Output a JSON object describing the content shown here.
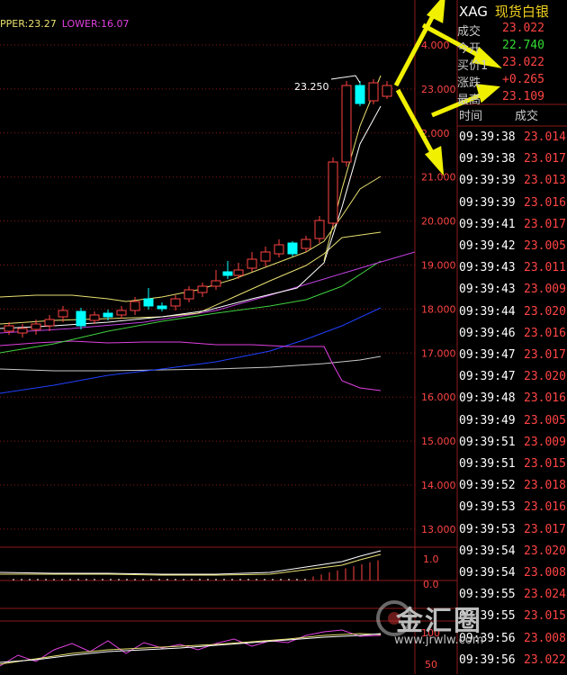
{
  "indicator_top": {
    "upper": "PPER:23.27",
    "lower": "LOWER:16.07"
  },
  "symbol": {
    "code": "XAG",
    "name": "现货白银"
  },
  "quote": [
    {
      "label": "成交",
      "value": "23.022",
      "color": "#ff4444"
    },
    {
      "label": "今开",
      "value": "22.740",
      "color": "#33dd33"
    },
    {
      "label": "买价1",
      "value": "23.022",
      "color": "#ff4444"
    },
    {
      "label": "涨跌",
      "value": "+0.265",
      "color": "#ff4444"
    },
    {
      "label": "最高",
      "value": "23.109",
      "color": "#ff4444"
    }
  ],
  "ticks_header": {
    "time": "时间",
    "price": "成交"
  },
  "ticks": [
    {
      "time": "09:39:38",
      "price": "23.014"
    },
    {
      "time": "09:39:38",
      "price": "23.017"
    },
    {
      "time": "09:39:39",
      "price": "23.013"
    },
    {
      "time": "09:39:39",
      "price": "23.016"
    },
    {
      "time": "09:39:41",
      "price": "23.017"
    },
    {
      "time": "09:39:42",
      "price": "23.005"
    },
    {
      "time": "09:39:43",
      "price": "23.011"
    },
    {
      "time": "09:39:43",
      "price": "23.009"
    },
    {
      "time": "09:39:44",
      "price": "23.020"
    },
    {
      "time": "09:39:46",
      "price": "23.016"
    },
    {
      "time": "09:39:47",
      "price": "23.017"
    },
    {
      "time": "09:39:47",
      "price": "23.020"
    },
    {
      "time": "09:39:48",
      "price": "23.016"
    },
    {
      "time": "09:39:49",
      "price": "23.005"
    },
    {
      "time": "09:39:51",
      "price": "23.009"
    },
    {
      "time": "09:39:51",
      "price": "23.015"
    },
    {
      "time": "09:39:52",
      "price": "23.018"
    },
    {
      "time": "09:39:53",
      "price": "23.016"
    },
    {
      "time": "09:39:53",
      "price": "23.017"
    },
    {
      "time": "09:39:54",
      "price": "23.020"
    },
    {
      "time": "09:39:54",
      "price": "23.008"
    },
    {
      "time": "09:39:55",
      "price": "23.024"
    },
    {
      "time": "09:39:55",
      "price": "23.015"
    },
    {
      "time": "09:39:56",
      "price": "23.008"
    },
    {
      "time": "09:39:56",
      "price": "23.022"
    }
  ],
  "price_axis": [
    "4.000",
    "23.000",
    "2.000",
    "21.000",
    "20.000",
    "19.000",
    "18.000",
    "17.000",
    "16.000",
    "15.000",
    "14.000",
    "13.000"
  ],
  "mid_axis": [
    "1.0",
    "0.0"
  ],
  "low_axis": [
    "100",
    "50"
  ],
  "high_label": "23.250",
  "watermark": {
    "text": "金汇圈",
    "url": "www.jrwlw.com"
  },
  "colors": {
    "up": "#ff4444",
    "down": "#00ffff",
    "grid": "#8b1a1a",
    "ma1": "#ffffff",
    "ma2": "#e8e070",
    "ma3": "#e040e0",
    "ma4": "#40d040",
    "ma5": "#2040ff"
  }
}
